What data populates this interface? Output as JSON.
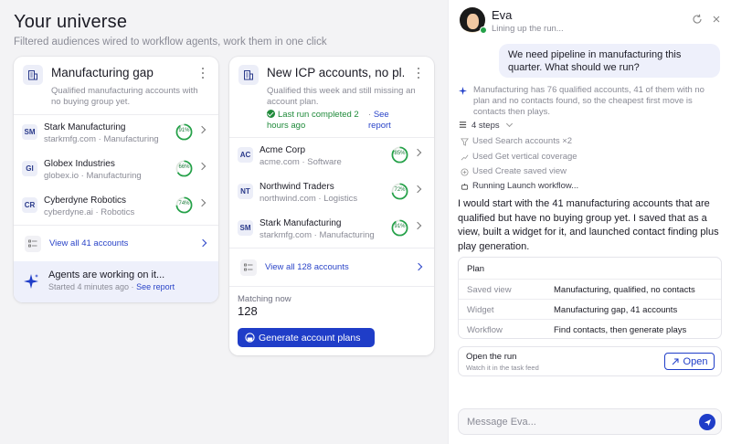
{
  "page": {
    "title": "Your universe",
    "subtitle": "Filtered audiences wired to workflow agents, work them in one click"
  },
  "cards": [
    {
      "title": "Manufacturing gap",
      "description": "Qualified manufacturing accounts with no buying group yet.",
      "accounts": [
        {
          "badge": "SM",
          "name": "Stark Manufacturing",
          "meta": "starkmfg.com · Manufacturing",
          "score": 91,
          "score_label": "91%"
        },
        {
          "badge": "GI",
          "name": "Globex Industries",
          "meta": "globex.io · Manufacturing",
          "score": 66,
          "score_label": "66%"
        },
        {
          "badge": "CR",
          "name": "Cyberdyne Robotics",
          "meta": "cyberdyne.ai · Robotics",
          "score": 74,
          "score_label": "74%"
        }
      ],
      "view_all_label": "View all 41 accounts",
      "agents_title": "Agents are working on it...",
      "agents_sub_prefix": "Started 4 minutes ago · ",
      "agents_sub_link": "See report"
    },
    {
      "title": "New ICP accounts, no pl...",
      "description": "Qualified this week and still missing an account plan.",
      "status_text": "Last run completed 2 hours ago",
      "status_sep": "·",
      "see_report": "See report",
      "accounts": [
        {
          "badge": "AC",
          "name": "Acme Corp",
          "meta": "acme.com · Software",
          "score": 85,
          "score_label": "85%"
        },
        {
          "badge": "NT",
          "name": "Northwind Traders",
          "meta": "northwind.com · Logistics",
          "score": 72,
          "score_label": "72%"
        },
        {
          "badge": "SM",
          "name": "Stark Manufacturing",
          "meta": "starkmfg.com · Manufacturing",
          "score": 91,
          "score_label": "91%"
        }
      ],
      "view_all_label": "View all 128 accounts",
      "matching_label": "Matching now",
      "matching_value": "128",
      "generate_label": "Generate account plans"
    }
  ],
  "chat": {
    "agent_name": "Eva",
    "agent_status": "Lining up the run...",
    "user_message": "We need pipeline in manufacturing this quarter. What should we run?",
    "ai_note": "Manufacturing has 76 qualified accounts, 41 of them with no plan and no contacts found, so the cheapest first move is contacts then plays.",
    "steps_label": "4 steps",
    "steps": [
      "Used Search accounts ×2",
      "Used Get vertical coverage",
      "Used Create saved view",
      "Running Launch workflow..."
    ],
    "reply": "I would start with the 41 manufacturing accounts that are qualified but have no buying group yet. I saved that as a view, built a widget for it, and launched contact finding plus play generation.",
    "plan": {
      "title": "Plan",
      "rows": [
        {
          "key": "Saved view",
          "value": "Manufacturing, qualified, no contacts"
        },
        {
          "key": "Widget",
          "value": "Manufacturing gap, 41 accounts"
        },
        {
          "key": "Workflow",
          "value": "Find contacts, then generate plays"
        }
      ]
    },
    "run": {
      "title": "Open the run",
      "subtitle": "Watch it in the task feed",
      "button": "Open"
    },
    "input_placeholder": "Message Eva..."
  },
  "colors": {
    "accent": "#1f3dc8",
    "success": "#1f8a3a",
    "ring": "#24a148"
  }
}
